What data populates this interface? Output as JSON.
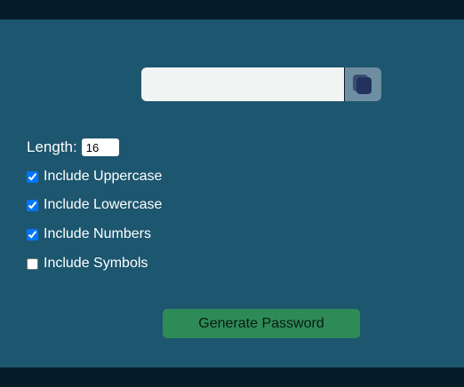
{
  "password_output": {
    "value": "",
    "placeholder": ""
  },
  "copy_button": {
    "icon": "copy-icon"
  },
  "length": {
    "label": "Length:",
    "value": "16"
  },
  "options": [
    {
      "label": "Include Uppercase",
      "checked": true
    },
    {
      "label": "Include Lowercase",
      "checked": true
    },
    {
      "label": "Include Numbers",
      "checked": true
    },
    {
      "label": "Include Symbols",
      "checked": false
    }
  ],
  "generate_button": {
    "label": "Generate Password"
  },
  "colors": {
    "page_background": "#051c29",
    "panel_background": "#1d566f",
    "button_background": "#2e8b57",
    "copy_button_background": "#6d8fa1"
  }
}
